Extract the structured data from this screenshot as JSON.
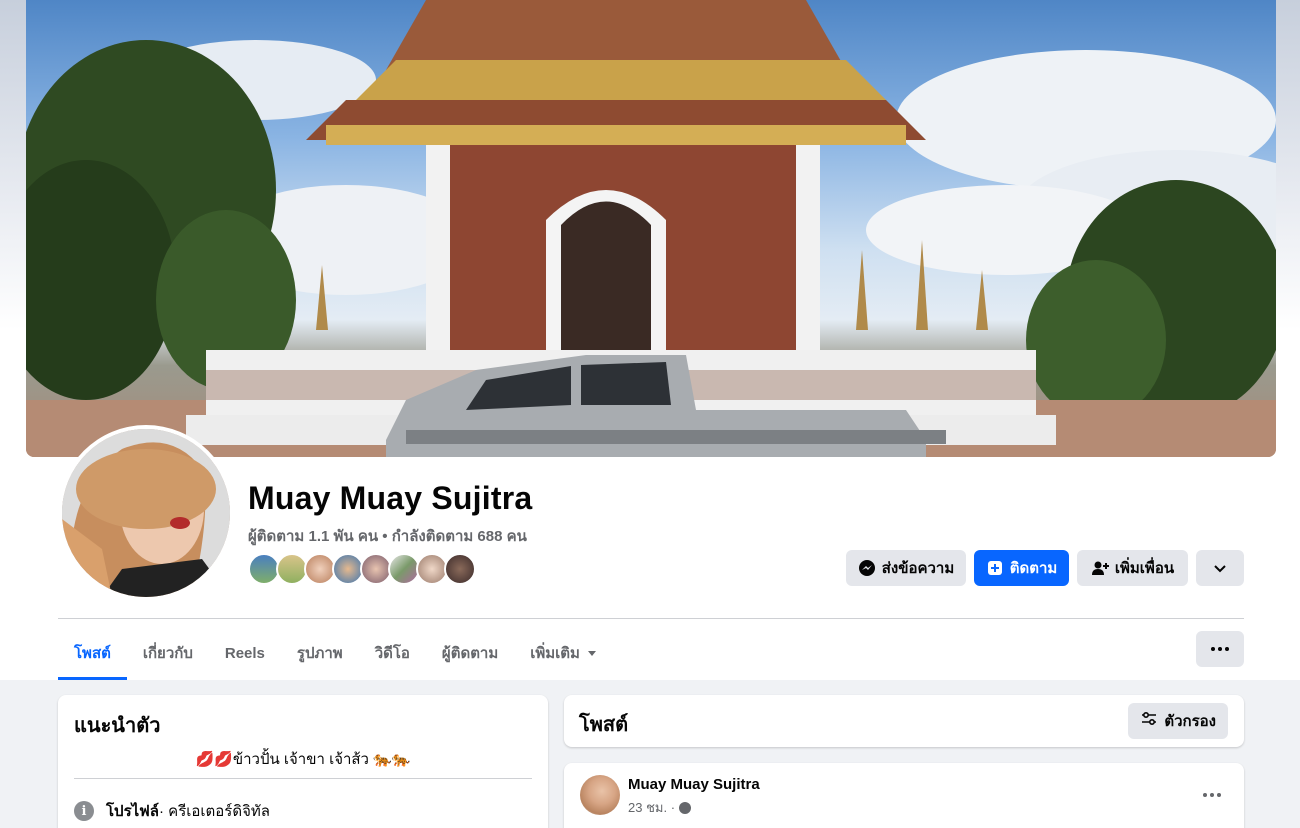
{
  "profile": {
    "name": "Muay Muay Sujitra",
    "followers_line": "ผู้ติดตาม 1.1 พัน คน • กำลังติดตาม 688 คน"
  },
  "actions": {
    "message": "ส่งข้อความ",
    "follow": "ติดตาม",
    "add_friend": "เพิ่มเพื่อน"
  },
  "tabs": [
    {
      "label": "โพสต์",
      "active": true
    },
    {
      "label": "เกี่ยวกับ"
    },
    {
      "label": "Reels"
    },
    {
      "label": "รูปภาพ"
    },
    {
      "label": "วิดีโอ"
    },
    {
      "label": "ผู้ติดตาม"
    },
    {
      "label": "เพิ่มเติม"
    }
  ],
  "intro": {
    "title": "แนะนำตัว",
    "bio": "💋💋ข้าวปั้น เจ้าขา เจ้าส้ว 🐅🐅",
    "profile_label": "โปรไฟล์",
    "profile_category": " · ครีเอเตอร์ดิจิทัล"
  },
  "posts": {
    "title": "โพสต์",
    "filter_label": "ตัวกรอง"
  },
  "post": {
    "author": "Muay Muay Sujitra",
    "time": "23 ชม. ·"
  },
  "colors": {
    "primary": "#0866ff",
    "button_gray": "#e4e6eb",
    "secondary_text": "#65676b"
  }
}
